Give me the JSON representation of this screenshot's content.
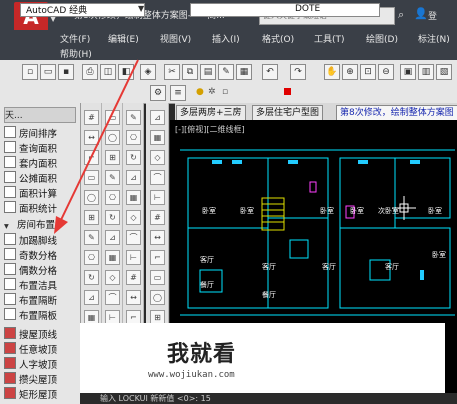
{
  "titlebar": {
    "app_logo": "A",
    "title": "第8次修改，绘制整体方案图------商...",
    "search_placeholder": "键入关键字或短语",
    "login": "登"
  },
  "menu": {
    "row1": [
      "文件(F)",
      "编辑(E)",
      "视图(V)",
      "插入(I)",
      "格式(O)",
      "工具(T)",
      "绘图(D)",
      "标注(N)"
    ],
    "row2": [
      "帮助(H)"
    ]
  },
  "toolbar2": {
    "workspace": "AutoCAD 经典",
    "layer": "DOTE"
  },
  "left_panel": {
    "header": "天...",
    "items": [
      "房间排序",
      "查询面积",
      "套内面积",
      "公摊面积",
      "面积计算",
      "面积统计",
      "房间布置",
      "加踢脚线",
      "奇数分格",
      "偶数分格",
      "布置洁具",
      "布置隔断",
      "布置隔板",
      "搜屋顶线",
      "任意坡顶",
      "人字坡顶",
      "攒尖屋顶",
      "矩形屋顶"
    ]
  },
  "tabs": [
    "多层两房+三房",
    "多层住宅户型图",
    "第8次修改，绘制整体方案图"
  ],
  "canvas": {
    "viewport_label": "[-][俯视][二维线框]",
    "rooms": [
      "卧室",
      "卧室",
      "卧室",
      "卧室",
      "次卧室",
      "卧室",
      "客厅",
      "餐厅",
      "客厅",
      "餐厅",
      "客厅",
      "客厅",
      "卧室"
    ]
  },
  "command": {
    "text": "输入    LOCKUI   新新值  <0>: 15"
  },
  "watermark": {
    "brand": "我就看",
    "url": "www.wojiukan.com"
  }
}
